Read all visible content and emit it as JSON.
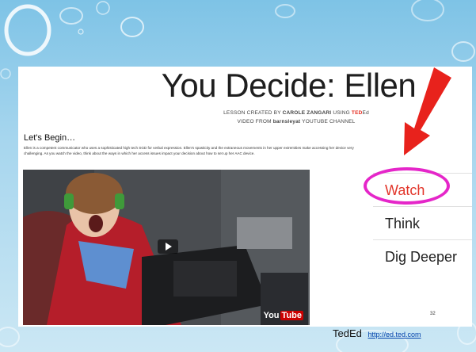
{
  "page": {
    "title": "You Decide: Ellen",
    "credit_line1_prefix": "LESSON CREATED BY",
    "credit_author": "CAROLE ZANGARI",
    "credit_using": "USING",
    "credit_brand_ted": "TED",
    "credit_brand_ed": "Ed",
    "credit_line2_prefix": "VIDEO FROM",
    "credit_channel": "barnsleyat",
    "credit_line2_suffix": "YOUTUBE CHANNEL",
    "section_heading": "Let's Begin…",
    "description": "Ellen is a competent communicator who uses a sophisticated high tech SGD for verbal expression. Ellen's spasticity and the extraneous movements in her upper extremities make accessing her device very challenging. As you watch the video, think about the ways in which her access issues impact your decision about how to set up her AAC device."
  },
  "menu": {
    "items": [
      {
        "label": "Watch",
        "active": true
      },
      {
        "label": "Think",
        "active": false
      },
      {
        "label": "Dig Deeper",
        "active": false
      }
    ]
  },
  "video": {
    "watermark_you": "You",
    "watermark_tube": "Tube"
  },
  "slide": {
    "page_number": "32",
    "footer_label": "TedEd",
    "footer_link": "http://ed.ted.com"
  },
  "colors": {
    "arrow": "#e8221c",
    "highlight_circle": "#e526c9",
    "active_menu": "#e2352a",
    "ted_red": "#e62b1e"
  }
}
